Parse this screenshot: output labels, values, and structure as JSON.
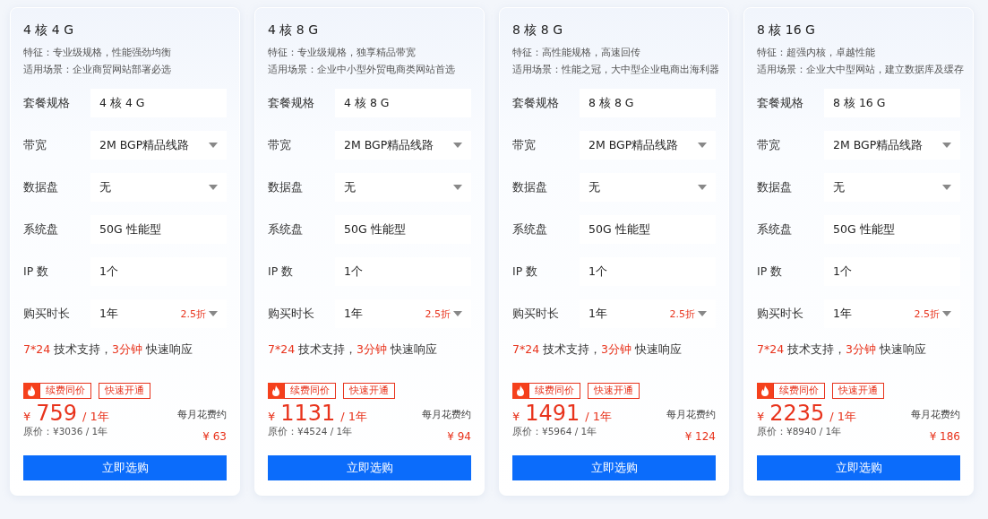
{
  "plans": [
    {
      "title": "4 核 4 G",
      "feature": "特征：专业级规格，性能强劲均衡",
      "scenario": "适用场景：企业商贸网站部署必选",
      "rows": [
        {
          "label": "套餐规格",
          "kind": "text",
          "value": "4 核 4 G"
        },
        {
          "label": "带宽",
          "kind": "select",
          "value": "2M BGP精品线路"
        },
        {
          "label": "数据盘",
          "kind": "select",
          "value": "无"
        },
        {
          "label": "系统盘",
          "kind": "text",
          "value": "50G 性能型"
        },
        {
          "label": "IP 数",
          "kind": "text",
          "value": "1个"
        },
        {
          "label": "购买时长",
          "kind": "select",
          "value": "1年",
          "discount": "2.5折"
        }
      ],
      "support": [
        {
          "text": "7*24",
          "accent": true
        },
        {
          "text": " 技术支持，",
          "accent": false
        },
        {
          "text": "3分钟",
          "accent": true
        },
        {
          "text": " 快速响应",
          "accent": false
        }
      ],
      "tags": [
        "续费同价",
        "快速开通"
      ],
      "currency": "¥",
      "price": "759",
      "period": "/ 1年",
      "original": "原价：¥3036 / 1年",
      "monthly_label": "每月花费约",
      "monthly": "¥ 63",
      "button": "立即选购"
    },
    {
      "title": "4 核 8 G",
      "feature": "特征：专业级规格，独享精品带宽",
      "scenario": "适用场景：企业中小型外贸电商类网站首选",
      "rows": [
        {
          "label": "套餐规格",
          "kind": "text",
          "value": "4 核 8 G"
        },
        {
          "label": "带宽",
          "kind": "select",
          "value": "2M BGP精品线路"
        },
        {
          "label": "数据盘",
          "kind": "select",
          "value": "无"
        },
        {
          "label": "系统盘",
          "kind": "text",
          "value": "50G 性能型"
        },
        {
          "label": "IP 数",
          "kind": "text",
          "value": "1个"
        },
        {
          "label": "购买时长",
          "kind": "select",
          "value": "1年",
          "discount": "2.5折"
        }
      ],
      "support": [
        {
          "text": "7*24",
          "accent": true
        },
        {
          "text": " 技术支持，",
          "accent": false
        },
        {
          "text": "3分钟",
          "accent": true
        },
        {
          "text": " 快速响应",
          "accent": false
        }
      ],
      "tags": [
        "续费同价",
        "快速开通"
      ],
      "currency": "¥",
      "price": "1131",
      "period": "/ 1年",
      "original": "原价：¥4524 / 1年",
      "monthly_label": "每月花费约",
      "monthly": "¥ 94",
      "button": "立即选购"
    },
    {
      "title": "8 核 8 G",
      "feature": "特征：高性能规格，高速回传",
      "scenario": "适用场景：性能之冠，大中型企业电商出海利器",
      "rows": [
        {
          "label": "套餐规格",
          "kind": "text",
          "value": "8 核 8 G"
        },
        {
          "label": "带宽",
          "kind": "select",
          "value": "2M BGP精品线路"
        },
        {
          "label": "数据盘",
          "kind": "select",
          "value": "无"
        },
        {
          "label": "系统盘",
          "kind": "text",
          "value": "50G 性能型"
        },
        {
          "label": "IP 数",
          "kind": "text",
          "value": "1个"
        },
        {
          "label": "购买时长",
          "kind": "select",
          "value": "1年",
          "discount": "2.5折"
        }
      ],
      "support": [
        {
          "text": "7*24",
          "accent": true
        },
        {
          "text": " 技术支持，",
          "accent": false
        },
        {
          "text": "3分钟",
          "accent": true
        },
        {
          "text": " 快速响应",
          "accent": false
        }
      ],
      "tags": [
        "续费同价",
        "快速开通"
      ],
      "currency": "¥",
      "price": "1491",
      "period": "/ 1年",
      "original": "原价：¥5964 / 1年",
      "monthly_label": "每月花费约",
      "monthly": "¥ 124",
      "button": "立即选购"
    },
    {
      "title": "8 核 16 G",
      "feature": "特征：超强内核，卓越性能",
      "scenario": "适用场景：企业大中型网站，建立数据库及缓存",
      "rows": [
        {
          "label": "套餐规格",
          "kind": "text",
          "value": "8 核 16 G"
        },
        {
          "label": "带宽",
          "kind": "select",
          "value": "2M BGP精品线路"
        },
        {
          "label": "数据盘",
          "kind": "select",
          "value": "无"
        },
        {
          "label": "系统盘",
          "kind": "text",
          "value": "50G 性能型"
        },
        {
          "label": "IP 数",
          "kind": "text",
          "value": "1个"
        },
        {
          "label": "购买时长",
          "kind": "select",
          "value": "1年",
          "discount": "2.5折"
        }
      ],
      "support": [
        {
          "text": "7*24",
          "accent": true
        },
        {
          "text": " 技术支持，",
          "accent": false
        },
        {
          "text": "3分钟",
          "accent": true
        },
        {
          "text": " 快速响应",
          "accent": false
        }
      ],
      "tags": [
        "续费同价",
        "快速开通"
      ],
      "currency": "¥",
      "price": "2235",
      "period": "/ 1年",
      "original": "原价：¥8940 / 1年",
      "monthly_label": "每月花费约",
      "monthly": "¥ 186",
      "button": "立即选购"
    }
  ]
}
